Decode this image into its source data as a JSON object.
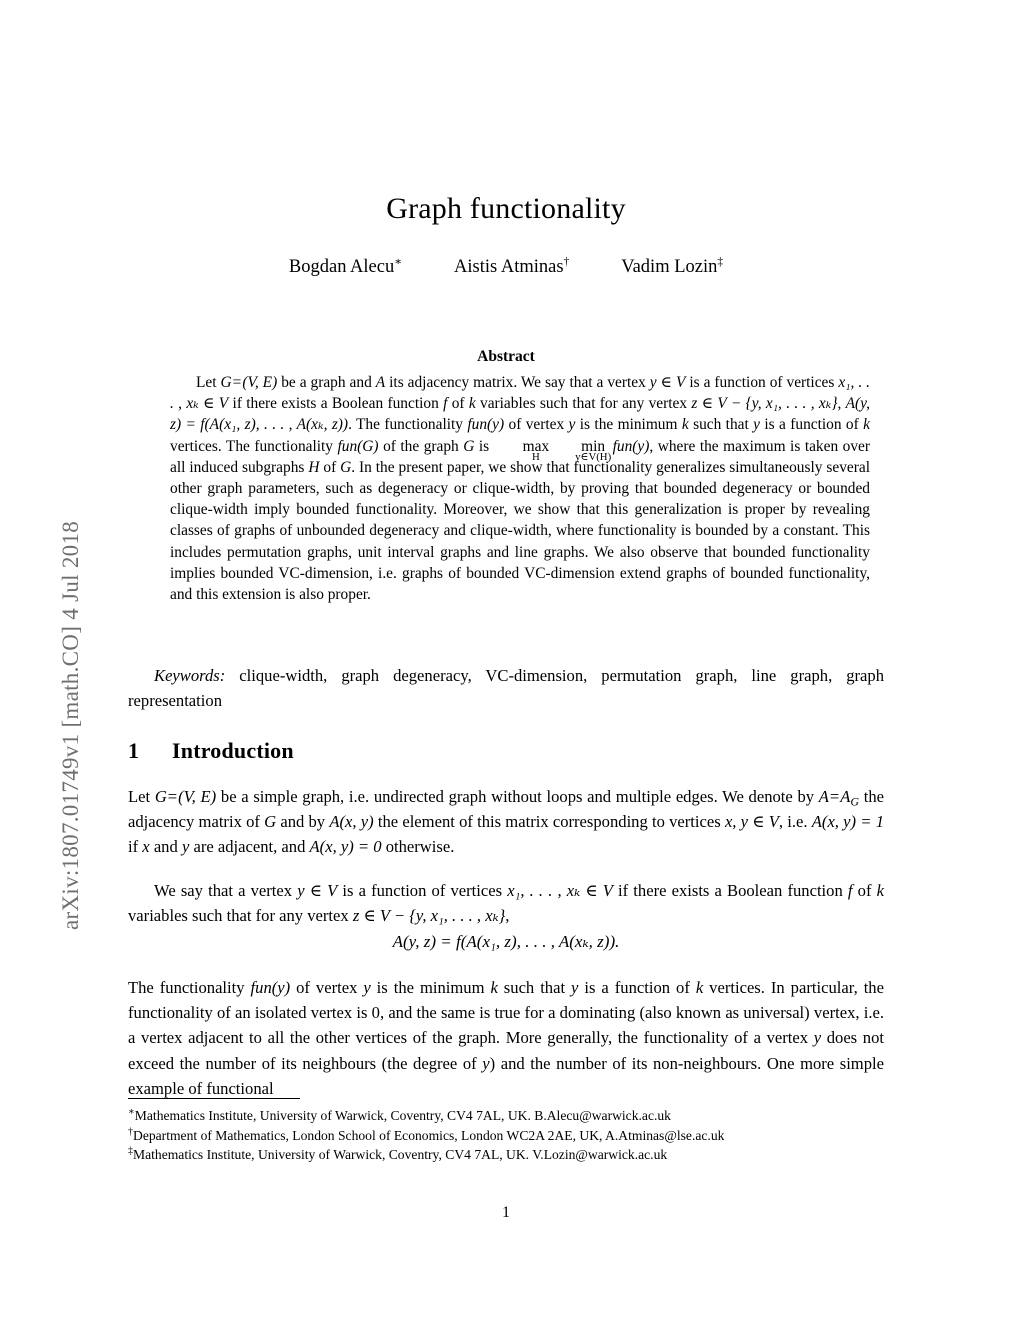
{
  "arxiv_stamp": "arXiv:1807.01749v1  [math.CO]  4 Jul 2018",
  "paper": {
    "title": "Graph functionality",
    "authors": [
      {
        "name": "Bogdan Alecu",
        "marker": "∗"
      },
      {
        "name": "Aistis Atminas",
        "marker": "†"
      },
      {
        "name": "Vadim Lozin",
        "marker": "‡"
      }
    ],
    "abstract": {
      "heading": "Abstract",
      "text_part_1": "Let ",
      "text_part_2": " be a graph and ",
      "text_part_3": " its adjacency matrix. We say that a vertex ",
      "text_part_4": " is a function of vertices ",
      "text_part_5": " if there exists a Boolean function ",
      "text_part_6": " of ",
      "text_part_7": " variables such that for any vertex ",
      "text_part_8": ". The functionality ",
      "text_part_9": " of vertex ",
      "text_part_10": " is the minimum ",
      "text_part_11": " such that ",
      "text_part_12": " is a function of ",
      "text_part_13": " vertices. The functionality ",
      "text_part_14": " of the graph ",
      "text_part_15": " is ",
      "text_part_16": ", where the maximum is taken over all induced subgraphs ",
      "text_part_17": " of ",
      "text_part_18": ". In the present paper, we show that functionality generalizes simultaneously several other graph parameters, such as degeneracy or clique-width, by proving that bounded degeneracy or bounded clique-width imply bounded functionality. Moreover, we show that this generalization is proper by revealing classes of graphs of unbounded degeneracy and clique-width, where functionality is bounded by a constant. This includes permutation graphs, unit interval graphs and line graphs. We also observe that bounded functionality implies bounded VC-dimension, i.e. graphs of bounded VC-dimension extend graphs of bounded functionality, and this extension is also proper."
    },
    "keywords": {
      "label": "Keywords:",
      "text": " clique-width, graph degeneracy, VC-dimension, permutation graph, line graph, graph representation"
    },
    "section": {
      "number": "1",
      "title": "Introduction"
    },
    "paragraph_1": {
      "p1": "Let ",
      "p2": " be a simple graph, i.e. undirected graph without loops and multiple edges. We denote by ",
      "p3": " the adjacency matrix of ",
      "p4": " and by ",
      "p5": " the element of this matrix corresponding to vertices ",
      "p6": ", i.e. ",
      "p7": " if ",
      "p8": " and ",
      "p9": " are adjacent, and ",
      "p10": " otherwise."
    },
    "paragraph_2": {
      "p1": "We say that a vertex ",
      "p2": " is a function of vertices ",
      "p3": " if there exists a Boolean function ",
      "p4": " of ",
      "p5": " variables such that for any vertex ",
      "p6": ","
    },
    "paragraph_3": {
      "p1": "The functionality ",
      "p2": " of vertex ",
      "p3": " is the minimum ",
      "p4": " such that ",
      "p5": " is a function of ",
      "p6": " vertices. In particular, the functionality of an isolated vertex is 0, and the same is true for a dominating (also known as universal) vertex, i.e. a vertex adjacent to all the other vertices of the graph. More generally, the functionality of a vertex ",
      "p7": " does not exceed the number of its neighbours (the degree of ",
      "p8": ") and the number of its non-neighbours. One more simple example of functional"
    },
    "footnotes": [
      {
        "marker": "∗",
        "text": "Mathematics Institute, University of Warwick, Coventry, CV4 7AL, UK. B.Alecu@warwick.ac.uk"
      },
      {
        "marker": "†",
        "text": "Department of Mathematics, London School of Economics, London WC2A 2AE, UK, A.Atminas@lse.ac.uk"
      },
      {
        "marker": "‡",
        "text": "Mathematics Institute, University of Warwick, Coventry, CV4 7AL, UK. V.Lozin@warwick.ac.uk"
      }
    ],
    "page_number": "1"
  },
  "math": {
    "G": "G",
    "VE": "(V, E)",
    "A": "A",
    "y_in_V": "y ∈ V",
    "x1_xk_in_V": "x₁, . . . , xₖ ∈ V",
    "f": "f",
    "k": "k",
    "z_in_V_minus": "z ∈ V − {y, x₁, . . . , xₖ}",
    "Ayz_eq": "A(y, z) = f(A(x₁, z), . . . , A(xₖ, z))",
    "fun_y": "fun(y)",
    "fun_G": "fun(G)",
    "max_op": "max",
    "max_limit": "H",
    "min_op": "min",
    "min_limit": "y∈V(H)",
    "H": "H",
    "A_eq_AG": "A = A_G",
    "Axy": "A(x, y)",
    "xy_in_V": "x, y ∈ V",
    "Axy_eq_1": "A(x, y) = 1",
    "x": "x",
    "y": "y",
    "Axy_eq_0": "A(x, y) = 0",
    "display_equation": "A(y, z) = f(A(x₁, z), . . . , A(xₖ, z))."
  }
}
